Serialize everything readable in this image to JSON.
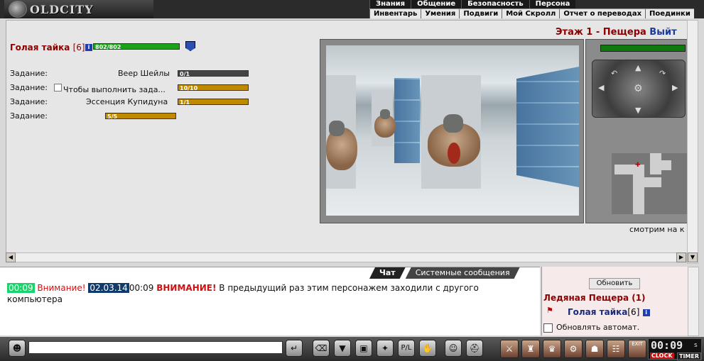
{
  "top_menu": {
    "logo_text": "OLDCITY",
    "row1": [
      "Знания",
      "Общение",
      "Безопасность",
      "Персона"
    ],
    "row2": [
      "Инвентарь",
      "Умения",
      "Подвиги",
      "Мой Скролл",
      "Отчет о переводах",
      "Поединки"
    ]
  },
  "location": {
    "floor_title": "Этаж 1 - Пещера",
    "exit_label": "Выйт"
  },
  "hero": {
    "name": "Голая тайка",
    "level": "[6]",
    "info_glyph": "i",
    "hp_text": "802/802",
    "hp_fraction": 1.0
  },
  "tasks": [
    {
      "label": "Задание:",
      "name": "Веер Шейлы",
      "progress_text": "0/1",
      "fraction": 0.0
    },
    {
      "label": "Задание:",
      "name": "Чтобы выполнить зада...",
      "progress_text": "10/10",
      "fraction": 1.0
    },
    {
      "label": "Задание:",
      "name": "Эссенция Купидуна",
      "progress_text": "1/1",
      "fraction": 1.0
    },
    {
      "label": "Задание:",
      "name": "",
      "progress_text": "5/5",
      "fraction": 1.0
    }
  ],
  "view": {
    "look_text": "смотрим на к"
  },
  "chat": {
    "tabs": [
      "Чат",
      "Системные сообщения"
    ],
    "message": {
      "time1": "00:09",
      "warn1": "Внимание!",
      "date": "02.03.14",
      "time2": "00:09",
      "warn2": "ВНИМАНИЕ!",
      "text": "В предыдущий раз этим персонажем заходили с другого компьютера"
    }
  },
  "right_panel": {
    "refresh_label": "Обновить",
    "location_name": "Ледяная Пещера (1)",
    "player_name": "Голая тайка",
    "player_level": "[6]",
    "auto_refresh_label": "Обновлять автомат."
  },
  "clock": {
    "time": "00:09",
    "seconds_label": "s",
    "clock_label": "CLOCK",
    "timer_label": "TIMER",
    "exit_label": "EXIT"
  },
  "colors": {
    "hp_bar": "#1aa31a",
    "task_bar": "#c08a00",
    "hero_name": "#8a0000"
  },
  "icons": {
    "bottom_left": [
      "head-icon",
      "enter-icon",
      "eraser-icon",
      "filter-icon",
      "monitor-icon",
      "dance-icon",
      "pl-icon",
      "hand-icon",
      "smile-icon",
      "helmet-icon"
    ],
    "bottom_right": [
      "fight-icon",
      "bag-icon",
      "treasure-icon",
      "gear-icon",
      "people-icon",
      "group-icon",
      "exit-icon"
    ]
  }
}
